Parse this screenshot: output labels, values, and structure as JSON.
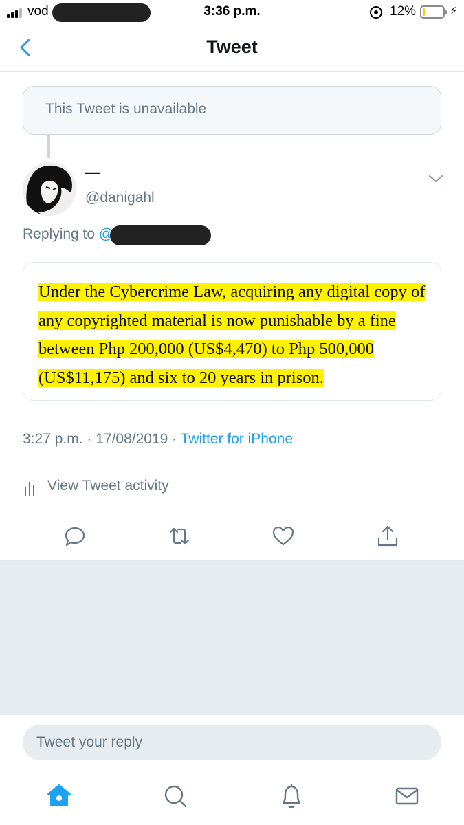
{
  "status_bar": {
    "carrier": "vod",
    "time": "3:36 p.m.",
    "battery_percent": "12%",
    "battery_level": 0.12
  },
  "header": {
    "title": "Tweet",
    "back_icon": "chevron-left-icon"
  },
  "unavailable_tweet": {
    "text": "This Tweet is unavailable"
  },
  "tweet": {
    "display_name": "—",
    "handle": "@danigahl",
    "replying_to_label": "Replying to",
    "replying_to_at": "@",
    "image_text": "Under the Cybercrime Law, acquiring any digital copy of any copyrighted material is now punishable by a fine between Php 200,000 (US$4,470) to Php 500,000 (US$11,175) and six to 20 years in prison.",
    "highlight_color": "#fff200",
    "timestamp": "3:27 p.m. · 17/08/2019 · ",
    "source": "Twitter for iPhone"
  },
  "activity": {
    "label": "View Tweet activity",
    "icon": "bar-chart-icon"
  },
  "actions": [
    {
      "name": "reply",
      "icon": "reply-icon"
    },
    {
      "name": "retweet",
      "icon": "retweet-icon"
    },
    {
      "name": "like",
      "icon": "heart-icon"
    },
    {
      "name": "share",
      "icon": "share-icon"
    }
  ],
  "reply_box": {
    "placeholder": "Tweet your reply"
  },
  "tab_bar": [
    {
      "name": "home",
      "icon": "home-icon",
      "active": true
    },
    {
      "name": "search",
      "icon": "search-icon",
      "active": false
    },
    {
      "name": "notifications",
      "icon": "bell-icon",
      "active": false
    },
    {
      "name": "messages",
      "icon": "mail-icon",
      "active": false
    }
  ],
  "colors": {
    "accent": "#1da1f2",
    "secondary_text": "#657786",
    "border": "#e1e8ed",
    "background_gray": "#e6ecf0"
  }
}
